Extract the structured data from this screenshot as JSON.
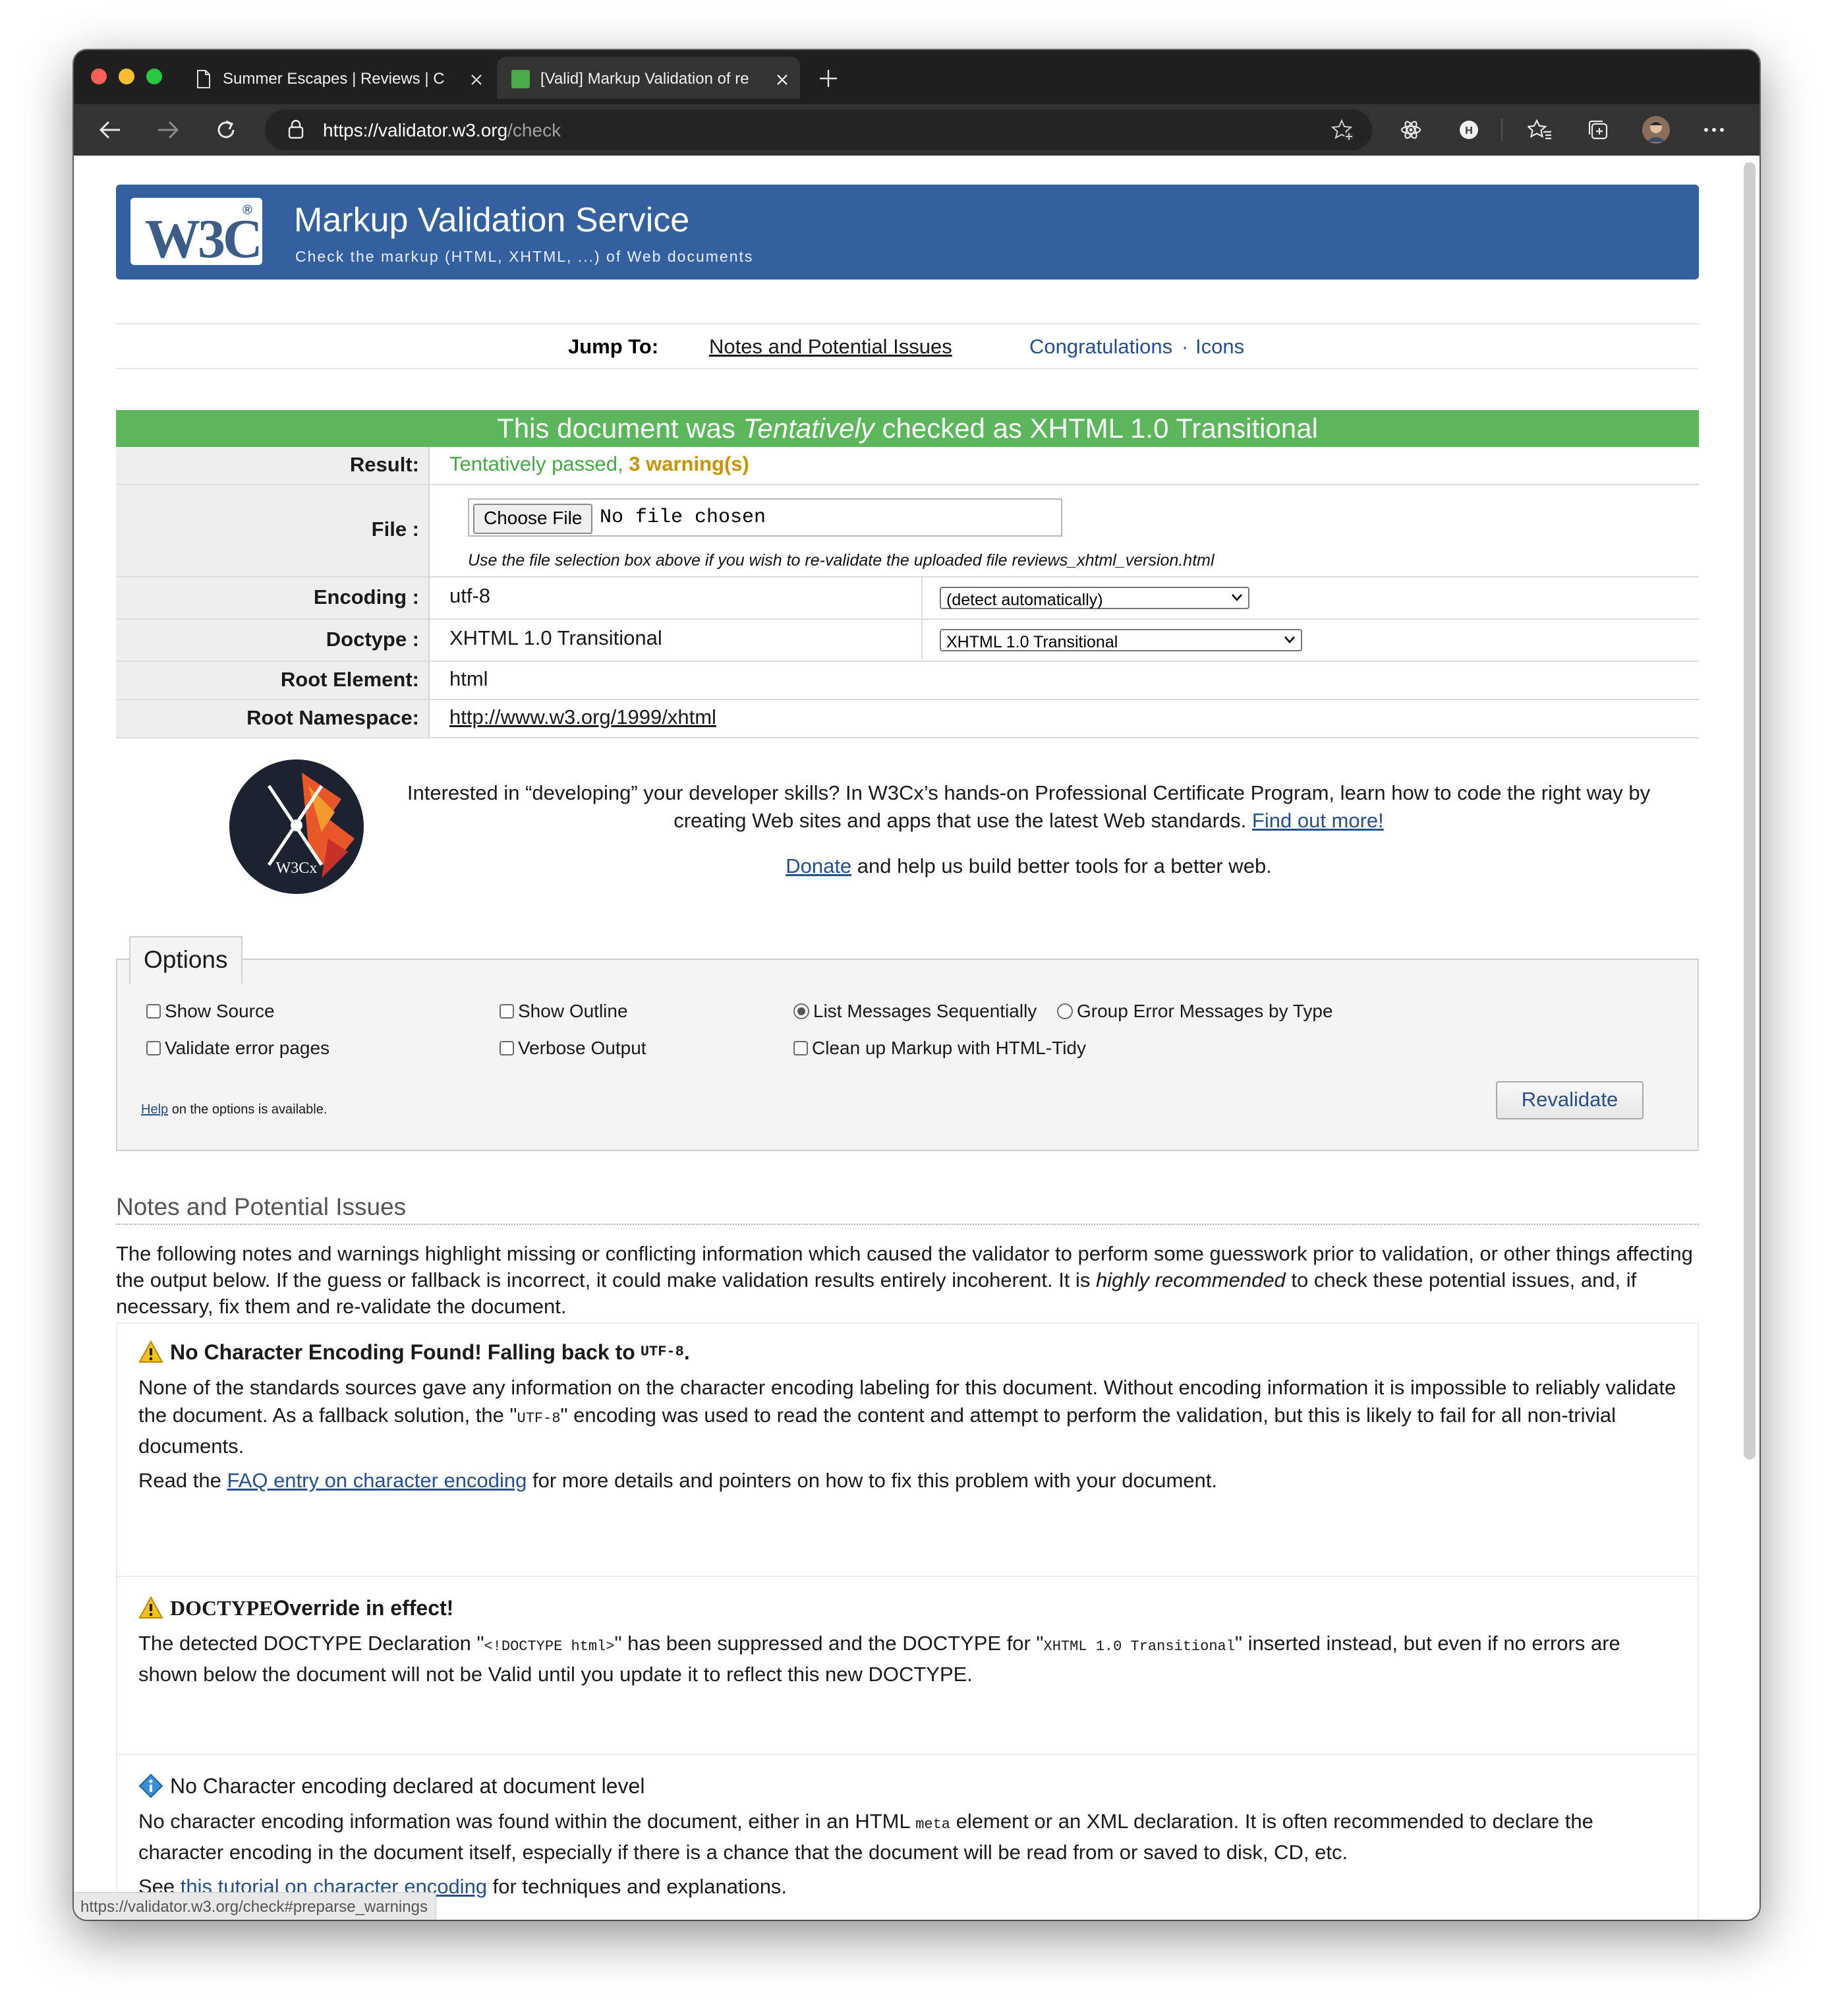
{
  "browser": {
    "tabs": [
      {
        "title": "Summer Escapes | Reviews | C"
      },
      {
        "title": "[Valid] Markup Validation of re"
      }
    ],
    "url_prefix": "https://",
    "url_host": "validator.w3.org",
    "url_path": "/check",
    "status_url": "https://validator.w3.org/check#preparse_warnings"
  },
  "header": {
    "logo_text": "W3C",
    "title": "Markup Validation Service",
    "subtitle": "Check the markup (HTML, XHTML, ...) of Web documents"
  },
  "jump": {
    "label": "Jump To:",
    "links": [
      "Notes and Potential Issues",
      "Congratulations",
      "Icons"
    ],
    "separator": "·"
  },
  "result": {
    "heading_pre": "This document was ",
    "heading_em": "Tentatively",
    "heading_post": " checked as XHTML 1.0 Transitional",
    "result_label": "Result:",
    "result_value": "Tentatively passed,",
    "result_warnings": "3 warning(s)",
    "file_label": "File :",
    "file_button": "Choose File",
    "file_status": "No file chosen",
    "file_note": "Use the file selection box above if you wish to re-validate the uploaded file reviews_xhtml_version.html",
    "encoding_label": "Encoding :",
    "encoding_value": "utf-8",
    "encoding_select": "(detect automatically)",
    "doctype_label": "Doctype :",
    "doctype_value": "XHTML 1.0 Transitional",
    "doctype_select": "XHTML 1.0 Transitional",
    "root_label": "Root Element:",
    "root_value": "html",
    "ns_label": "Root Namespace:",
    "ns_value": "http://www.w3.org/1999/xhtml"
  },
  "promo": {
    "text_1": "Interested in “developing” your developer skills? In W3Cx’s hands-on Professional Certificate Program, learn how to code the right way by creating Web sites and apps that use the latest Web standards.",
    "link": "Find out more!",
    "donate_link": "Donate",
    "donate_text": " and help us build better tools for a better web.",
    "badge_text": "W3Cx"
  },
  "options": {
    "legend": "Options",
    "show_source": "Show Source",
    "show_outline": "Show Outline",
    "list_seq": "List Messages Sequentially",
    "group_err": "Group Error Messages by Type",
    "validate_err": "Validate error pages",
    "verbose": "Verbose Output",
    "cleanup": "Clean up Markup with HTML-Tidy",
    "help_link": "Help",
    "help_text": " on the options is available.",
    "revalidate": "Revalidate"
  },
  "notes": {
    "title": "Notes and Potential Issues",
    "intro_1": "The following notes and warnings highlight missing or conflicting information which caused the validator to perform some guesswork prior to validation, or other things affecting the output below. If the guess or fallback is incorrect, it could make validation results entirely incoherent. It is ",
    "intro_em": "highly recommended",
    "intro_2": " to check these potential issues, and, if necessary, fix them and re-validate the document.",
    "m1_title": "No Character Encoding Found! Falling back to ",
    "m1_title_code": "UTF-8",
    "m1_title_end": ".",
    "m1_p1a": "None of the standards sources gave any information on the character encoding labeling for this document. Without encoding information it is impossible to reliably validate the document. As a fallback solution, the \"",
    "m1_p1_code": "UTF-8",
    "m1_p1b": "\" encoding was used to read the content and attempt to perform the validation, but this is likely to fail for all non-trivial documents.",
    "m1_p2a": "Read the ",
    "m1_p2_link": "FAQ entry on character encoding",
    "m1_p2b": " for more details and pointers on how to fix this problem with your document.",
    "m2_title_sc": "DOCTYPE",
    "m2_title": " Override in effect!",
    "m2_p1a": "The detected DOCTYPE Declaration \"",
    "m2_p1_code": "<!DOCTYPE html>",
    "m2_p1b": "\" has been suppressed and the DOCTYPE for \"",
    "m2_p1_code2": "XHTML 1.0 Transitional",
    "m2_p1c": "\" inserted instead, but even if no errors are shown below the document will not be Valid until you update it to reflect this new DOCTYPE.",
    "m3_title": "No Character encoding declared at document level",
    "m3_p1a": "No character encoding information was found within the document, either in an HTML ",
    "m3_p1_code": "meta",
    "m3_p1b": " element or an XML declaration. It is often recommended to declare the character encoding in the document itself, especially if there is a chance that the document will be read from or saved to disk, CD, etc.",
    "m3_p2a": "See ",
    "m3_p2_link": "this tutorial on character encoding",
    "m3_p2b": " for techniques and explanations."
  },
  "colors": {
    "banner": "#35609f",
    "success": "#5cb65c",
    "warning_text": "#c69400",
    "pass_text": "#4aa64a",
    "link": "#274f8a"
  },
  "icons": [
    "document-icon",
    "close-icon",
    "new-tab-icon",
    "back-icon",
    "forward-icon",
    "reload-icon",
    "lock-icon",
    "add-favorite-icon",
    "extension-icon",
    "profile-badge-icon",
    "favorites-icon",
    "collections-icon",
    "avatar",
    "more-icon",
    "warning-icon",
    "info-icon"
  ]
}
